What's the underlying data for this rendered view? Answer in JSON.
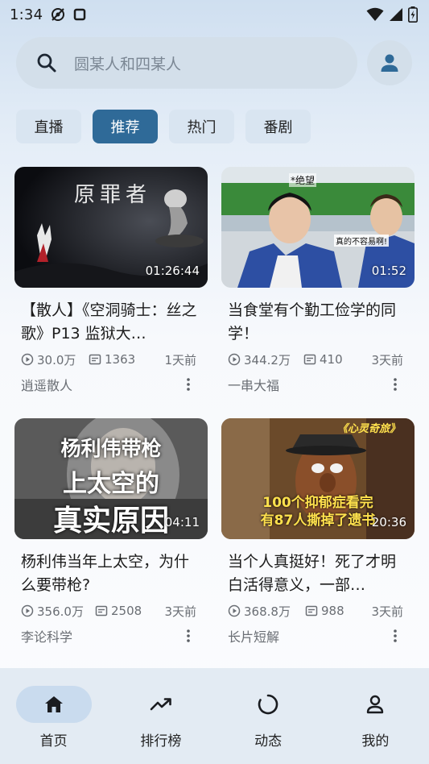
{
  "status_bar": {
    "time": "1:34",
    "icons": [
      "hotspot-off-icon",
      "square-icon",
      "wifi-icon",
      "signal-icon",
      "battery-charging-icon"
    ]
  },
  "search": {
    "placeholder": "圆某人和四某人"
  },
  "tabs": [
    {
      "label": "直播",
      "active": false
    },
    {
      "label": "推荐",
      "active": true
    },
    {
      "label": "热门",
      "active": false
    },
    {
      "label": "番剧",
      "active": false
    }
  ],
  "videos": [
    {
      "title": "【散人】《空洞骑士：丝之歌》P13 监狱大…",
      "thumb_text": "原罪者",
      "duration": "01:26:44",
      "views": "30.0万",
      "danmaku": "1363",
      "time": "1天前",
      "author": "逍遥散人"
    },
    {
      "title": "当食堂有个勤工俭学的同学！",
      "thumb_text": "*绝望",
      "thumb_caption": "真的不容易啊!",
      "duration": "01:52",
      "views": "344.2万",
      "danmaku": "410",
      "time": "3天前",
      "author": "一串大福"
    },
    {
      "title": "杨利伟当年上太空，为什么要带枪?",
      "thumb_text": "杨利伟带枪",
      "thumb_text_2": "上太空的",
      "thumb_text_3": "真实原因",
      "duration": "04:11",
      "views": "356.0万",
      "danmaku": "2508",
      "time": "3天前",
      "author": "李论科学"
    },
    {
      "title": "当个人真挺好！死了才明白活得意义，一部…",
      "thumb_text": "《心灵奇旅》",
      "thumb_text_2": "100个抑郁症看完",
      "thumb_text_3": "有87人撕掉了遗书",
      "duration": "20:36",
      "views": "368.8万",
      "danmaku": "988",
      "time": "3天前",
      "author": "长片短解"
    }
  ],
  "bottom_nav": [
    {
      "label": "首页",
      "icon": "home-icon",
      "active": true
    },
    {
      "label": "排行榜",
      "icon": "trending-icon",
      "active": false
    },
    {
      "label": "动态",
      "icon": "refresh-circle-icon",
      "active": false
    },
    {
      "label": "我的",
      "icon": "person-icon",
      "active": false
    }
  ],
  "colors": {
    "accent": "#2f6a98",
    "tab_bg": "#d9e5f1",
    "search_bg": "#d3dfea",
    "nav_bg": "#e3ebf3"
  }
}
